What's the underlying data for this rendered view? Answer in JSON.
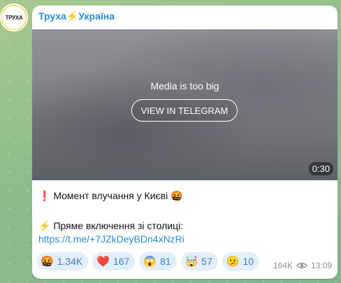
{
  "channel": {
    "name": "Труха⚡Україна",
    "avatar_text": "ТРУХА"
  },
  "media": {
    "notice": "Media is too big",
    "button_label": "VIEW IN TELEGRAM",
    "duration": "0:30"
  },
  "message": {
    "line1": "❗️ Момент влучання у Києві 🤬",
    "line2": "⚡ Пряме включення зі столиці:",
    "link": "https://t.me/+7JZkDeyBDn4xNzRi"
  },
  "reactions": [
    {
      "emoji": "🤬",
      "count": "1.34K"
    },
    {
      "emoji": "❤️",
      "count": "167"
    },
    {
      "emoji": "😱",
      "count": "81"
    },
    {
      "emoji": "🤯",
      "count": "57"
    },
    {
      "emoji": "🫤",
      "count": "10"
    }
  ],
  "meta": {
    "views": "194K",
    "time": "13:09",
    "views_icon": "eye-icon"
  }
}
